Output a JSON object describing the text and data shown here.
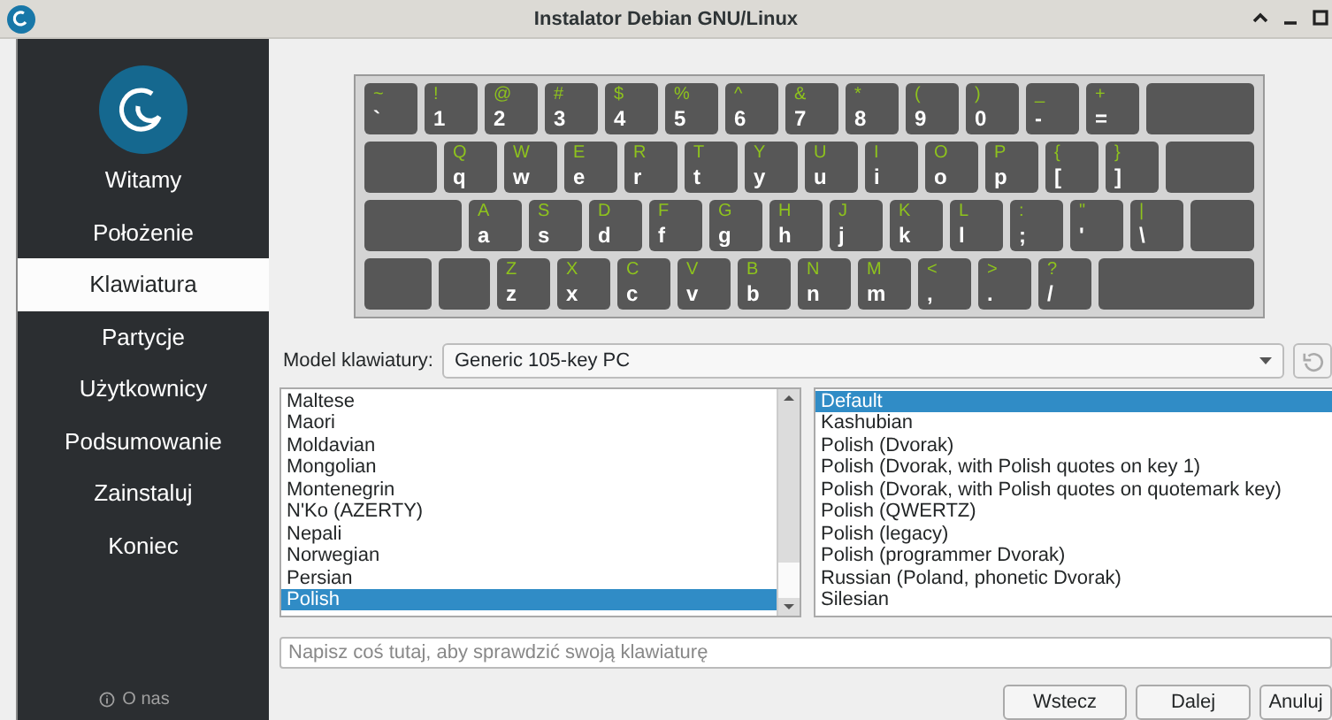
{
  "window": {
    "title": "Instalator Debian GNU/Linux"
  },
  "sidebar": {
    "items": [
      {
        "label": "Witamy",
        "selected": false
      },
      {
        "label": "Położenie",
        "selected": false
      },
      {
        "label": "Klawiatura",
        "selected": true
      },
      {
        "label": "Partycje",
        "selected": false
      },
      {
        "label": "Użytkownicy",
        "selected": false
      },
      {
        "label": "Podsumowanie",
        "selected": false
      },
      {
        "label": "Zainstaluj",
        "selected": false
      },
      {
        "label": "Koniec",
        "selected": false
      }
    ],
    "about": "O nas"
  },
  "keyboard": {
    "rows": [
      [
        {
          "kind": "char",
          "upper": "~",
          "lower": "`"
        },
        {
          "kind": "char",
          "upper": "!",
          "lower": "1"
        },
        {
          "kind": "char",
          "upper": "@",
          "lower": "2"
        },
        {
          "kind": "char",
          "upper": "#",
          "lower": "3"
        },
        {
          "kind": "char",
          "upper": "$",
          "lower": "4"
        },
        {
          "kind": "char",
          "upper": "%",
          "lower": "5"
        },
        {
          "kind": "char",
          "upper": "^",
          "lower": "6"
        },
        {
          "kind": "char",
          "upper": "&",
          "lower": "7"
        },
        {
          "kind": "char",
          "upper": "*",
          "lower": "8"
        },
        {
          "kind": "char",
          "upper": "(",
          "lower": "9"
        },
        {
          "kind": "char",
          "upper": ")",
          "lower": "0"
        },
        {
          "kind": "char",
          "upper": "_",
          "lower": "-"
        },
        {
          "kind": "char",
          "upper": "+",
          "lower": "="
        },
        {
          "kind": "backspace"
        }
      ],
      [
        {
          "kind": "tab"
        },
        {
          "kind": "char",
          "upper": "Q",
          "lower": "q"
        },
        {
          "kind": "char",
          "upper": "W",
          "lower": "w"
        },
        {
          "kind": "char",
          "upper": "E",
          "lower": "e"
        },
        {
          "kind": "char",
          "upper": "R",
          "lower": "r"
        },
        {
          "kind": "char",
          "upper": "T",
          "lower": "t"
        },
        {
          "kind": "char",
          "upper": "Y",
          "lower": "y"
        },
        {
          "kind": "char",
          "upper": "U",
          "lower": "u"
        },
        {
          "kind": "char",
          "upper": "I",
          "lower": "i"
        },
        {
          "kind": "char",
          "upper": "O",
          "lower": "o"
        },
        {
          "kind": "char",
          "upper": "P",
          "lower": "p"
        },
        {
          "kind": "char",
          "upper": "{",
          "lower": "["
        },
        {
          "kind": "char",
          "upper": "}",
          "lower": "]"
        },
        {
          "kind": "enter"
        }
      ],
      [
        {
          "kind": "caps"
        },
        {
          "kind": "char",
          "upper": "A",
          "lower": "a"
        },
        {
          "kind": "char",
          "upper": "S",
          "lower": "s"
        },
        {
          "kind": "char",
          "upper": "D",
          "lower": "d"
        },
        {
          "kind": "char",
          "upper": "F",
          "lower": "f"
        },
        {
          "kind": "char",
          "upper": "G",
          "lower": "g"
        },
        {
          "kind": "char",
          "upper": "H",
          "lower": "h"
        },
        {
          "kind": "char",
          "upper": "J",
          "lower": "j"
        },
        {
          "kind": "char",
          "upper": "K",
          "lower": "k"
        },
        {
          "kind": "char",
          "upper": "L",
          "lower": "l"
        },
        {
          "kind": "char",
          "upper": ":",
          "lower": ";"
        },
        {
          "kind": "char",
          "upper": "\"",
          "lower": "'"
        },
        {
          "kind": "char",
          "upper": "|",
          "lower": "\\"
        },
        {
          "kind": "enter"
        }
      ],
      [
        {
          "kind": "shift"
        },
        {
          "kind": "extra"
        },
        {
          "kind": "char",
          "upper": "Z",
          "lower": "z"
        },
        {
          "kind": "char",
          "upper": "X",
          "lower": "x"
        },
        {
          "kind": "char",
          "upper": "C",
          "lower": "c"
        },
        {
          "kind": "char",
          "upper": "V",
          "lower": "v"
        },
        {
          "kind": "char",
          "upper": "B",
          "lower": "b"
        },
        {
          "kind": "char",
          "upper": "N",
          "lower": "n"
        },
        {
          "kind": "char",
          "upper": "M",
          "lower": "m"
        },
        {
          "kind": "char",
          "upper": "<",
          "lower": ","
        },
        {
          "kind": "char",
          "upper": ">",
          "lower": "."
        },
        {
          "kind": "char",
          "upper": "?",
          "lower": "/"
        },
        {
          "kind": "rshift"
        }
      ]
    ]
  },
  "model": {
    "label": "Model klawiatury:",
    "value": "Generic 105-key PC"
  },
  "layouts": {
    "items": [
      {
        "label": "Maltese",
        "selected": false
      },
      {
        "label": "Maori",
        "selected": false
      },
      {
        "label": "Moldavian",
        "selected": false
      },
      {
        "label": "Mongolian",
        "selected": false
      },
      {
        "label": "Montenegrin",
        "selected": false
      },
      {
        "label": "N'Ko (AZERTY)",
        "selected": false
      },
      {
        "label": "Nepali",
        "selected": false
      },
      {
        "label": "Norwegian",
        "selected": false
      },
      {
        "label": "Persian",
        "selected": false
      },
      {
        "label": "Polish",
        "selected": true
      }
    ]
  },
  "variants": {
    "items": [
      {
        "label": "Default",
        "selected": true
      },
      {
        "label": "Kashubian",
        "selected": false
      },
      {
        "label": "Polish (Dvorak)",
        "selected": false
      },
      {
        "label": "Polish (Dvorak, with Polish quotes on key 1)",
        "selected": false
      },
      {
        "label": "Polish (Dvorak, with Polish quotes on quotemark key)",
        "selected": false
      },
      {
        "label": "Polish (QWERTZ)",
        "selected": false
      },
      {
        "label": "Polish (legacy)",
        "selected": false
      },
      {
        "label": "Polish (programmer Dvorak)",
        "selected": false
      },
      {
        "label": "Russian (Poland, phonetic Dvorak)",
        "selected": false
      },
      {
        "label": "Silesian",
        "selected": false
      }
    ]
  },
  "test_field": {
    "placeholder": "Napisz coś tutaj, aby sprawdzić swoją klawiaturę"
  },
  "buttons": [
    "Wstecz",
    "Dalej",
    "Anuluj"
  ]
}
